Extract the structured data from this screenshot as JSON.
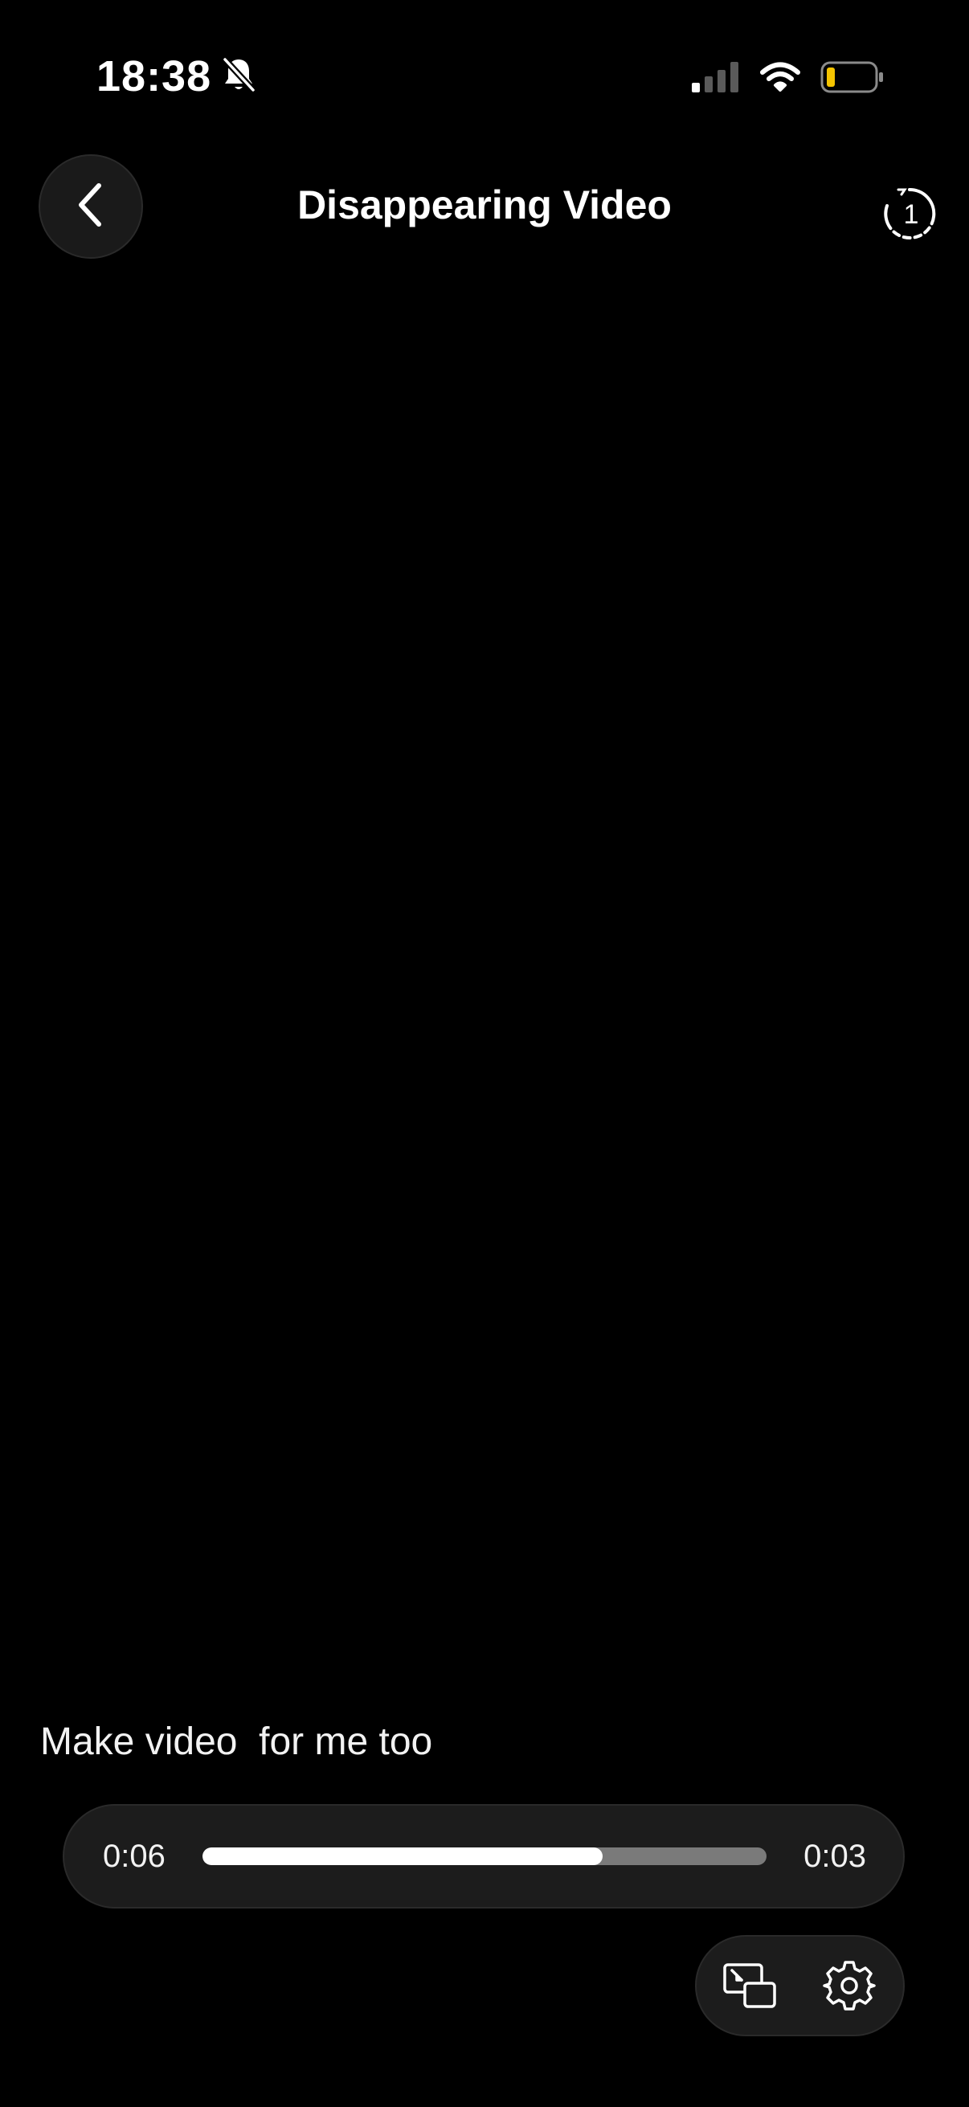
{
  "status_bar": {
    "time": "18:38",
    "mute_icon": "bell-slash-icon",
    "signal_icon": "cellular-signal-icon",
    "wifi_icon": "wifi-icon",
    "battery_icon": "battery-low-icon",
    "battery_color": "#f5c400"
  },
  "header": {
    "title": "Disappearing Video",
    "back_icon": "chevron-left-icon",
    "view_once_icon": "view-once-icon",
    "view_once_count": "1"
  },
  "caption": "Make video  for me too",
  "player": {
    "elapsed": "0:06",
    "remaining": "0:03",
    "progress": 0.71
  },
  "controls": {
    "pip_icon": "picture-in-picture-icon",
    "settings_icon": "gear-icon"
  },
  "colors": {
    "background": "#000000",
    "surface": "#1c1c1c",
    "track": "#7a7a7a",
    "fill": "#ffffff"
  }
}
